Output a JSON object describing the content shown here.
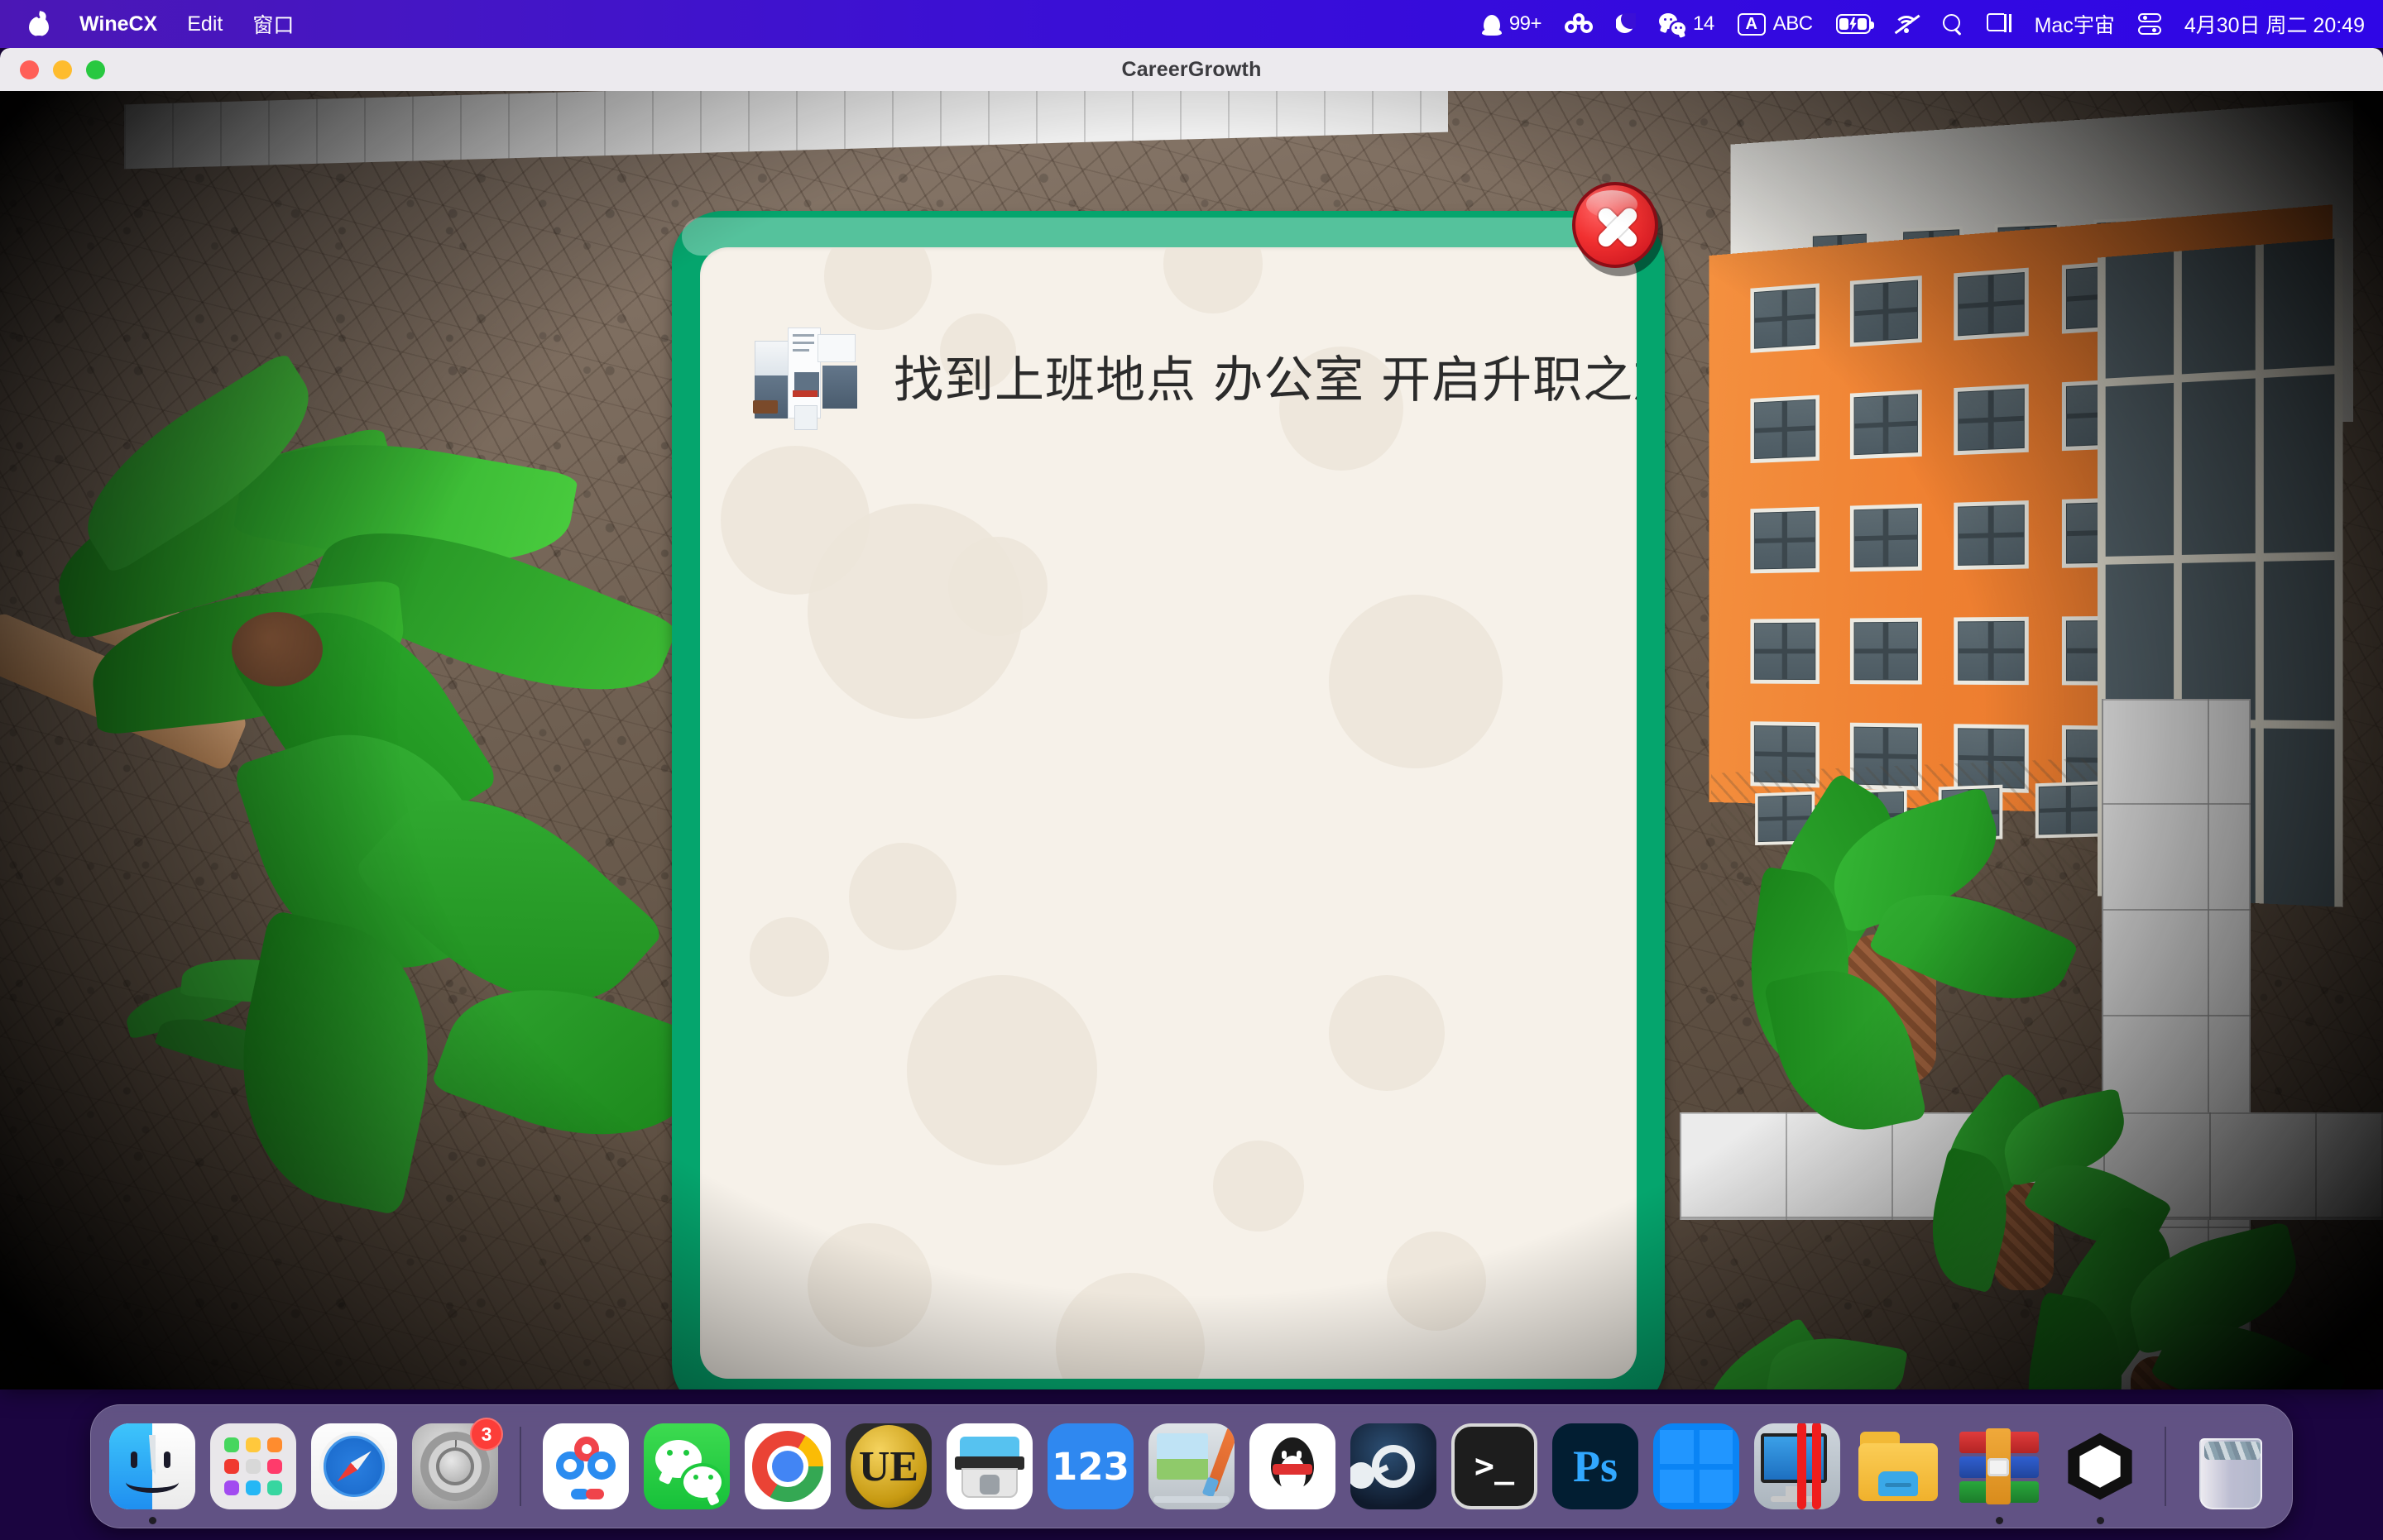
{
  "menubar": {
    "apple_icon": "apple-logo",
    "app_name": "WineCX",
    "menus": [
      "Edit",
      "窗口"
    ],
    "status": {
      "qq_icon": "qq-penguin-icon",
      "qq_count": "99+",
      "baidu_netdisk_icon": "baidu-netdisk-icon",
      "dnd_icon": "moon-icon",
      "wechat_icon": "wechat-icon",
      "wechat_count": "14",
      "input_source_icon": "letter-a-icon",
      "input_source": "ABC",
      "battery_icon": "battery-charging-icon",
      "wifi_icon": "wifi-off-icon",
      "search_icon": "search-icon",
      "screen_mirroring_icon": "screen-mirroring-icon",
      "user_name": "Mac宇宙",
      "control_center_icon": "control-center-icon",
      "datetime": "4月30日 周二 20:49"
    }
  },
  "window": {
    "title": "CareerGrowth",
    "traffic_lights": [
      "close",
      "minimize",
      "zoom"
    ]
  },
  "dialog": {
    "message": "找到上班地点 办公室 开启升职之旅!!",
    "thumbnail_icon": "office-building-thumbnail",
    "close_button_icon": "close-x-icon",
    "frame_color": "#05a56d",
    "panel_color": "#f6f1e9"
  },
  "scene": {
    "ground_color": "#6b5c4e",
    "building_color": "#ef8031",
    "path_color": "#ebebeb",
    "foliage_color": "#1f9b22"
  },
  "dock": {
    "items": [
      {
        "name": "finder",
        "label": "Finder",
        "running": true
      },
      {
        "name": "launchpad",
        "label": "Launchpad",
        "running": false
      },
      {
        "name": "safari",
        "label": "Safari",
        "running": false
      },
      {
        "name": "system-settings",
        "label": "System Settings",
        "badge": "3",
        "running": false
      },
      {
        "name": "baidu-netdisk",
        "label": "百度网盘",
        "running": false
      },
      {
        "name": "wechat",
        "label": "WeChat",
        "running": false
      },
      {
        "name": "chrome",
        "label": "Google Chrome",
        "running": false
      },
      {
        "name": "ultraedit",
        "label": "UltraEdit",
        "running": false
      },
      {
        "name": "archiver",
        "label": "Archiver",
        "running": false
      },
      {
        "name": "pan123",
        "label": "123",
        "running": false
      },
      {
        "name": "paintbrush",
        "label": "Paintbrush",
        "running": false
      },
      {
        "name": "qq",
        "label": "QQ",
        "running": false
      },
      {
        "name": "steam",
        "label": "Steam",
        "running": false
      },
      {
        "name": "terminal",
        "label": "Terminal",
        "running": false
      },
      {
        "name": "photoshop",
        "label": "Photoshop",
        "running": false
      },
      {
        "name": "windows",
        "label": "Windows",
        "running": false
      },
      {
        "name": "parallels",
        "label": "Parallels Desktop",
        "running": false
      },
      {
        "name": "folder",
        "label": "Folder",
        "running": false
      },
      {
        "name": "winrar",
        "label": "WinRAR",
        "running": true
      },
      {
        "name": "unity",
        "label": "Unity",
        "running": true
      },
      {
        "name": "trash",
        "label": "Trash",
        "running": false
      }
    ],
    "ultraedit_glyph": "UE",
    "pan123_glyph": "123",
    "photoshop_glyph": "Ps",
    "terminal_glyph": ">_"
  }
}
